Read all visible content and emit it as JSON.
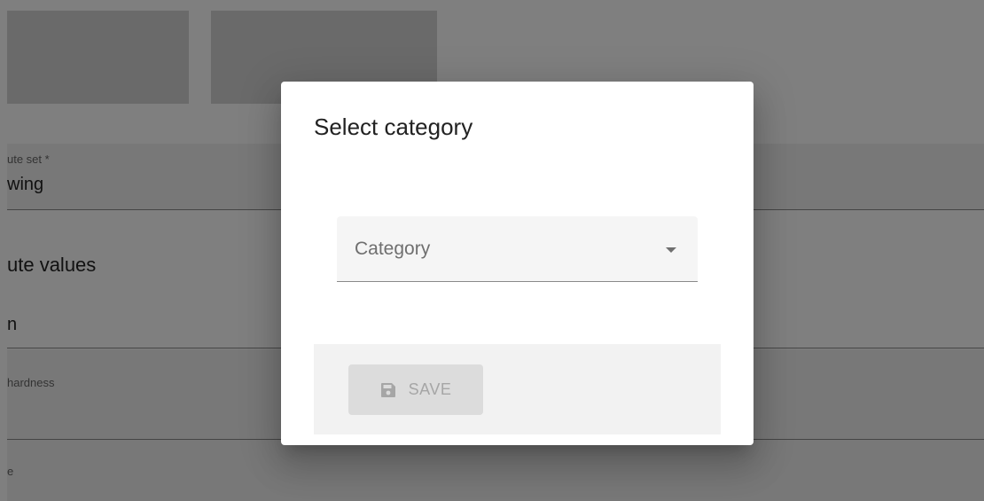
{
  "background": {
    "attribute_set_label": "ute set *",
    "attribute_set_value": "wing",
    "attribute_values_heading": "ute values",
    "item_value": "n",
    "hardness_label": "hardness",
    "e_label": "e"
  },
  "dialog": {
    "title": "Select category",
    "category_select": {
      "label": "Category",
      "selected_value": ""
    },
    "save_button": {
      "label": "SAVE",
      "icon": "floppy-disk-icon",
      "disabled": true
    }
  },
  "colors": {
    "overlay": "rgba(0,0,0,0.5)",
    "dialog_bg": "#ffffff",
    "field_bg": "#f5f5f5",
    "actions_bg": "#f2f2f2",
    "button_disabled_bg": "#dcdcdc",
    "button_disabled_text": "#a6a6a6"
  }
}
